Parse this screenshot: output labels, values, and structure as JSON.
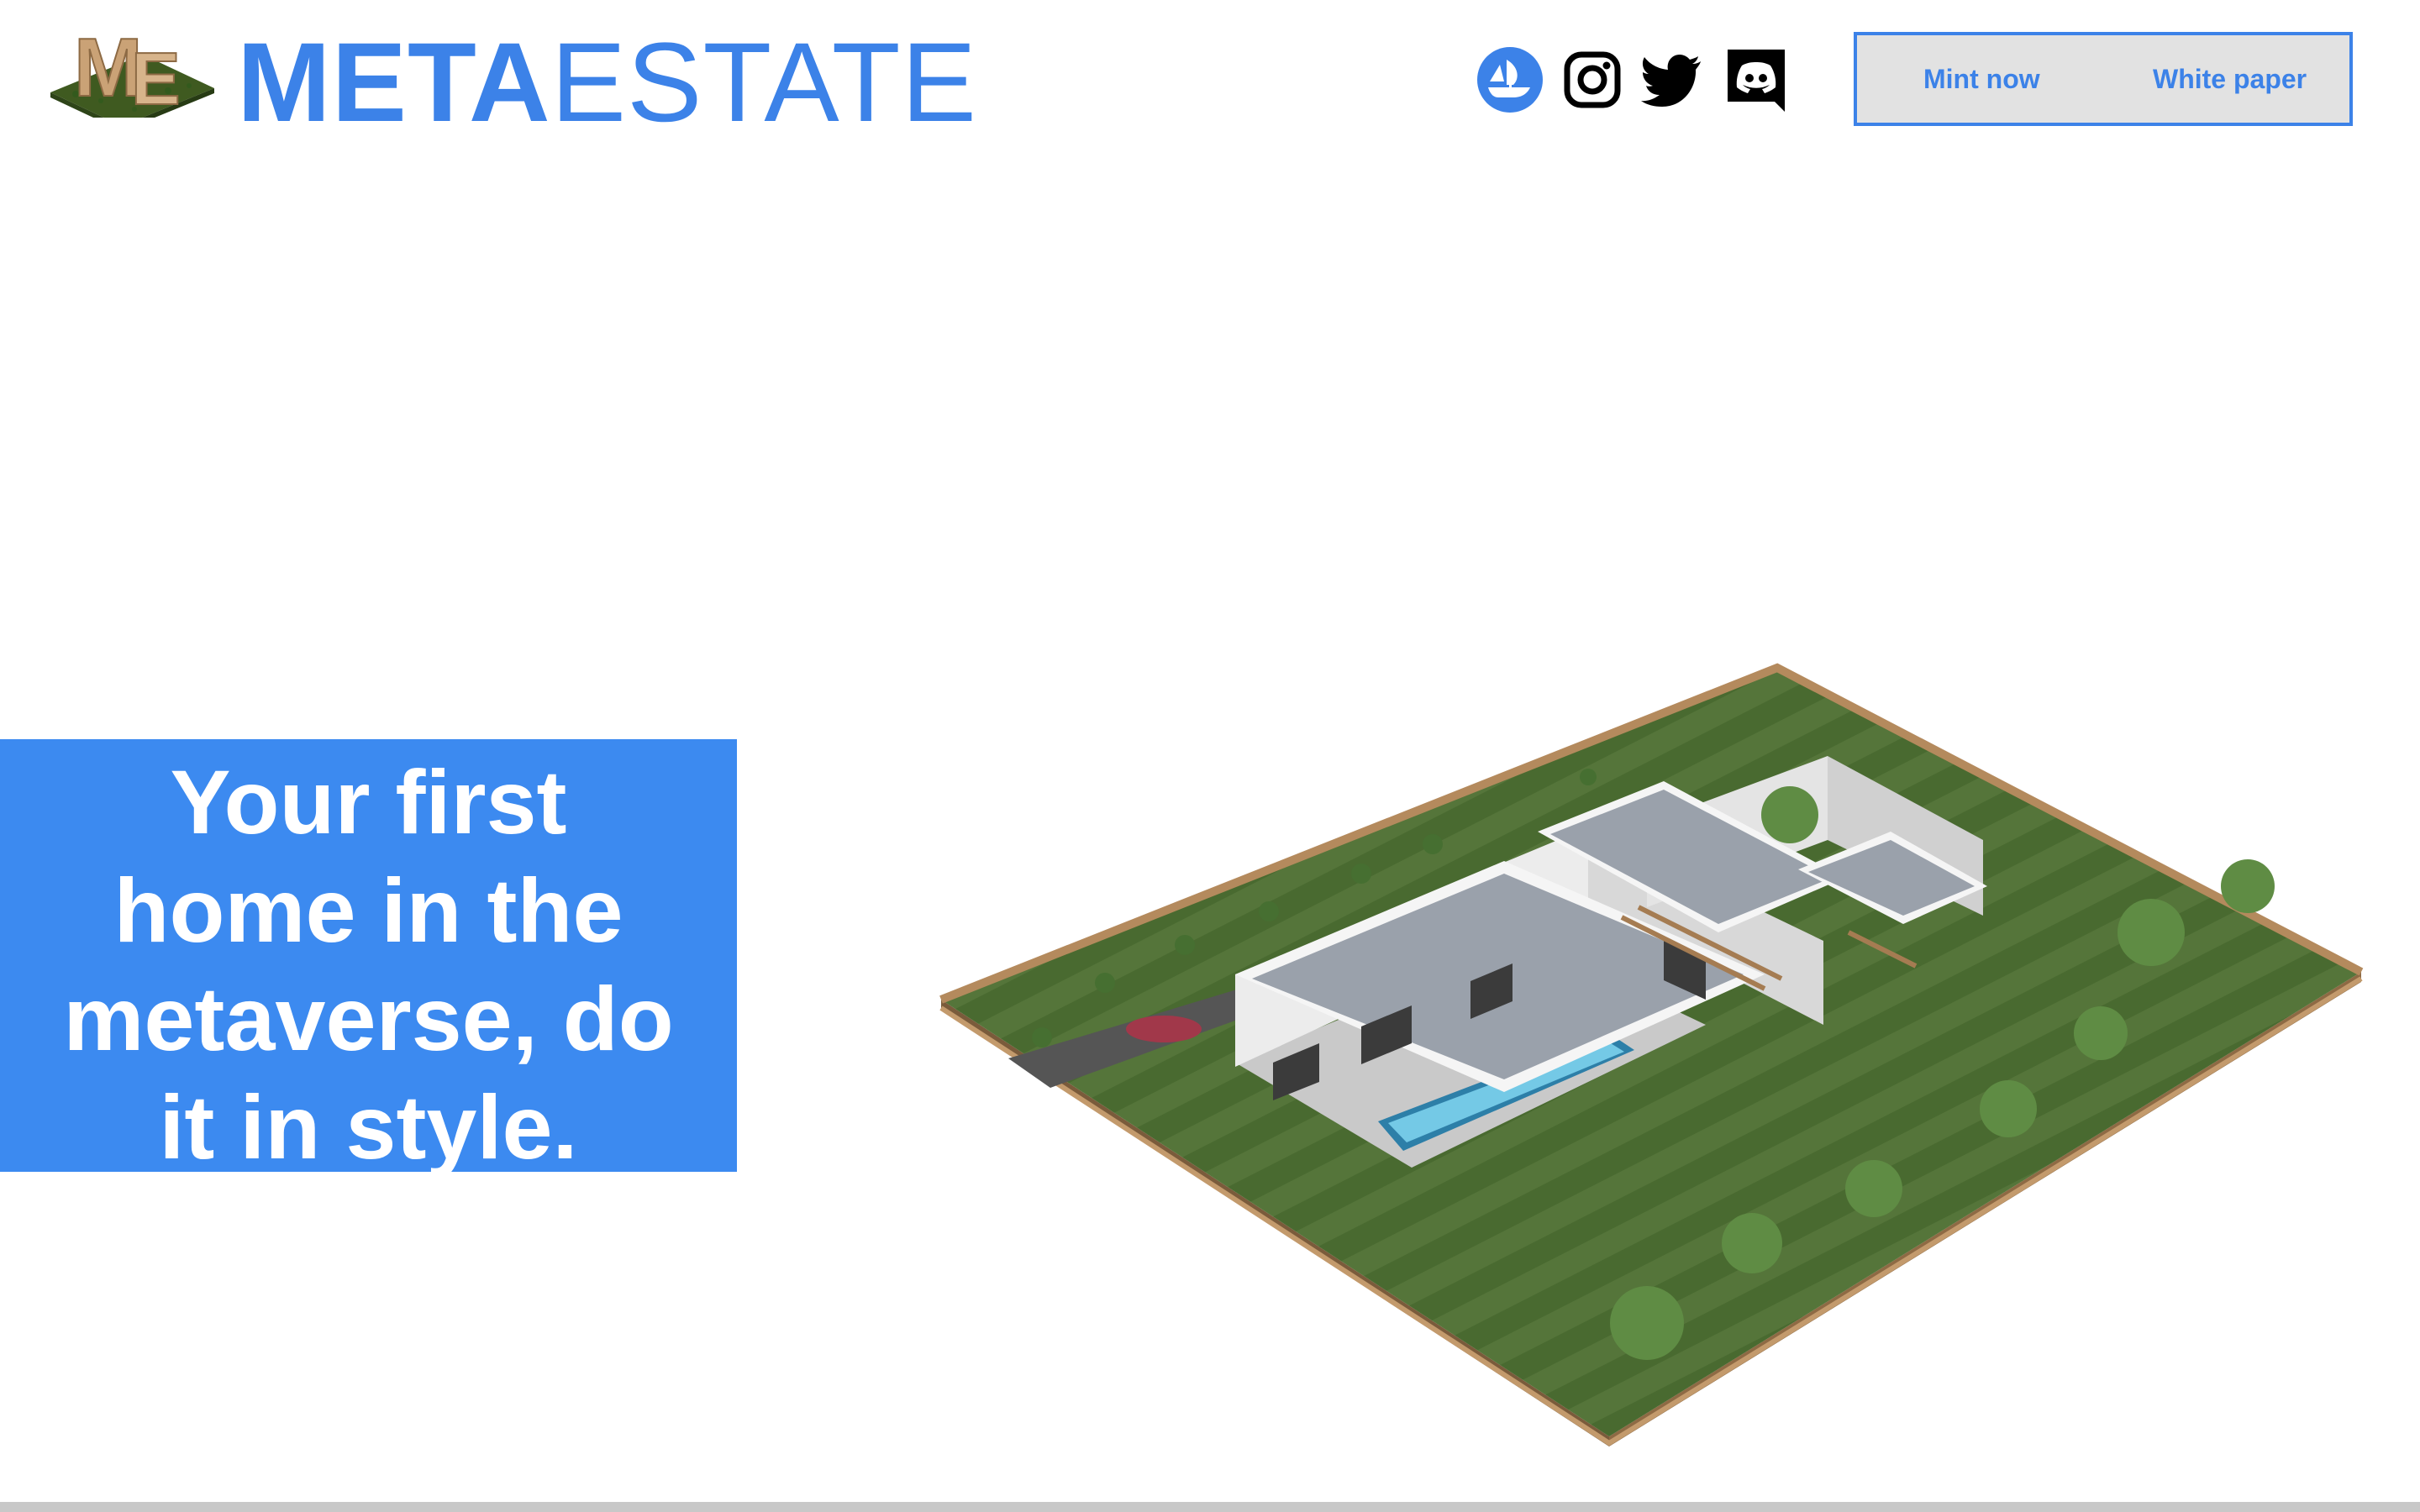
{
  "header": {
    "logo": {
      "letters": "ME"
    },
    "brand": {
      "bold": "META",
      "light": "ESTATE"
    },
    "social": [
      {
        "name": "opensea-icon"
      },
      {
        "name": "instagram-icon"
      },
      {
        "name": "twitter-icon"
      },
      {
        "name": "discord-icon"
      }
    ],
    "nav": {
      "mint_label": "Mint now",
      "whitepaper_label": "White paper"
    }
  },
  "hero": {
    "lines": [
      "Your first",
      "home in the",
      "metaverse, do",
      "it in style."
    ]
  },
  "colors": {
    "accent": "#3c82e8",
    "hero_bg": "#3c8af0",
    "nav_bg": "#e2e2e2"
  }
}
